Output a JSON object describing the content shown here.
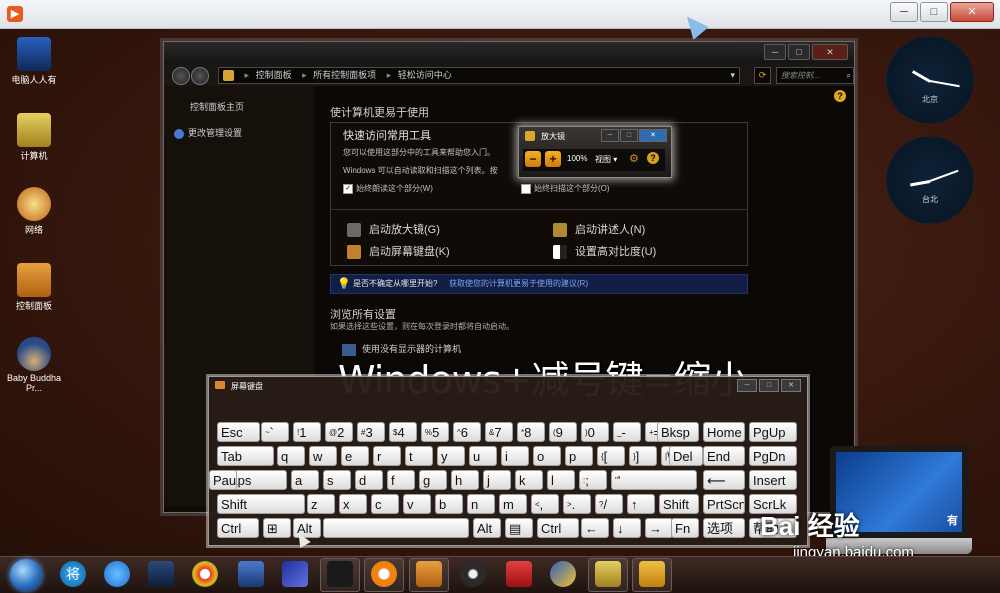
{
  "outer_window": {
    "icon_name": "app-icon",
    "ctrl_min": "─",
    "ctrl_max": "□",
    "ctrl_close": "✕"
  },
  "desktop_icons": [
    "电脑人人有",
    "计算机",
    "网络",
    "控制面板",
    "Baby Buddha Pr..."
  ],
  "control_panel": {
    "breadcrumb": [
      "控制面板",
      "所有控制面板项",
      "轻松访问中心"
    ],
    "search_placeholder": "搜索控制...",
    "left_nav": [
      "控制面板主页",
      "更改管理设置"
    ],
    "page_title": "使计算机更易于使用",
    "quick_access": {
      "title": "快速访问常用工具",
      "line1": "您可以使用这部分中的工具来帮助您入门。",
      "line2": "Windows 可以自动读取和扫描这个列表。按",
      "check_read": "始终朗读这个部分(W)",
      "check_scan": "始终扫描这个部分(O)",
      "link_magnifier": "启动放大镜(G)",
      "link_narrator": "启动讲述人(N)",
      "link_osk": "启动屏幕键盘(K)",
      "link_contrast": "设置高对比度(U)"
    },
    "tip": {
      "question": "是否不确定从哪里开始?",
      "link": "获取使您的计算机更易于使用的建议(R)"
    },
    "browse": {
      "title": "浏览所有设置",
      "desc": "如果选择这些设置，则在每次登录时都将自动启动。",
      "item1": "使用没有显示器的计算机"
    }
  },
  "magnifier": {
    "title": "放大镜",
    "zoom": "100%",
    "view": "视图 ▾"
  },
  "caption": "Windows+减号键=缩小",
  "osk": {
    "title": "屏幕键盘",
    "rows": [
      [
        "Esc",
        "~ `",
        "! 1",
        "@ 2",
        "# 3",
        "$ 4",
        "% 5",
        "^ 6",
        "& 7",
        "* 8",
        "( 9",
        ") 0",
        "_ -",
        "+ =",
        "Bksp",
        "Home",
        "PgUp"
      ],
      [
        "Tab",
        "q",
        "w",
        "e",
        "r",
        "t",
        "y",
        "u",
        "i",
        "o",
        "p",
        "{ [",
        "} ]",
        "| \\",
        "Del",
        "End",
        "PgDn"
      ],
      [
        "Caps",
        "a",
        "s",
        "d",
        "f",
        "g",
        "h",
        "j",
        "k",
        "l",
        ": ;",
        "\" '",
        "⟵",
        "Insert",
        "Pause"
      ],
      [
        "Shift",
        "z",
        "x",
        "c",
        "v",
        "b",
        "n",
        "m",
        "< ,",
        "> .",
        "? /",
        "↑",
        "Shift",
        "PrtScn",
        "ScrLk"
      ],
      [
        "Ctrl",
        "⊞",
        "Alt",
        "",
        "Alt",
        "▤",
        "Ctrl",
        "←",
        "↓",
        "→",
        "Fn",
        "选项",
        "帮助"
      ]
    ]
  },
  "gadgets": {
    "clock1_label": "北京",
    "clock2_label": "台北"
  },
  "laptop_text": "有",
  "watermark": {
    "logo": "Bai 经验",
    "url": "jingyan.baidu.com"
  },
  "taskbar_icons": [
    "start-orb",
    "jiang-icon",
    "ie-icon",
    "media-icon",
    "browser-icon",
    "toolbox-icon",
    "app-icon",
    "recorder-icon",
    "circle-app-icon",
    "panel-icon",
    "fan-icon",
    "headset-icon",
    "paint-icon",
    "computer-icon",
    "folder-icon"
  ],
  "taskbar_jiang": "将"
}
